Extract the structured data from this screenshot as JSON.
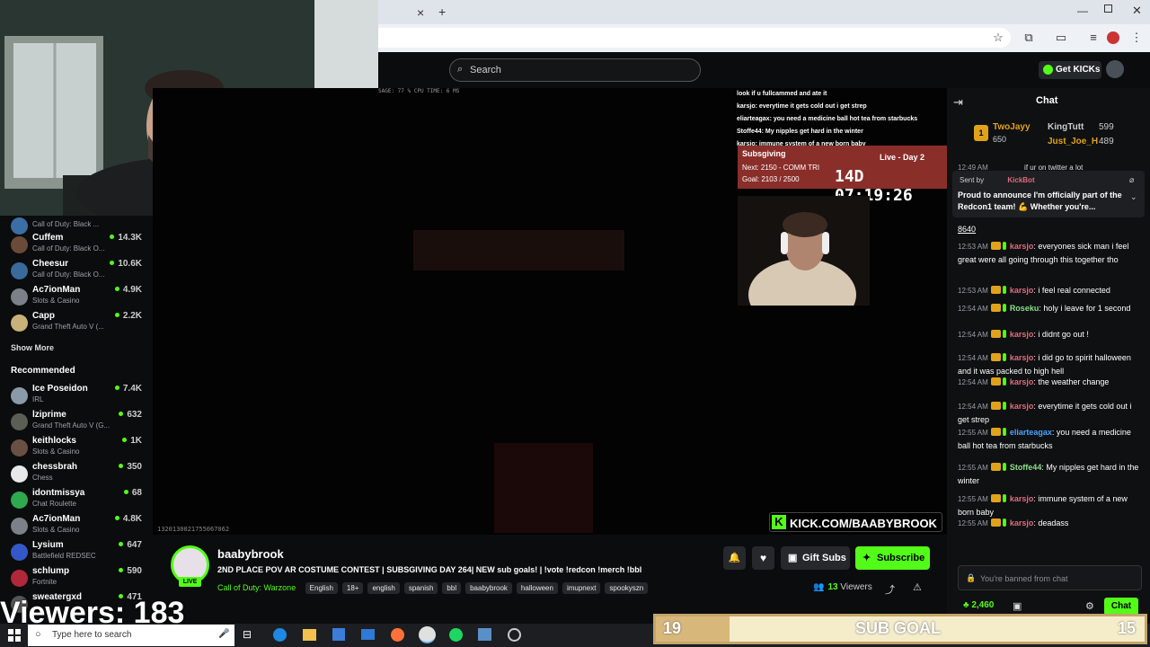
{
  "browser": {
    "tab_close": "×",
    "tab_add": "+"
  },
  "header": {
    "search_placeholder": "Search",
    "get_kicks": "Get KICKs"
  },
  "sidebar": {
    "top_items": [
      {
        "name": "",
        "category": "Call of Duty: Black ...",
        "viewers": ""
      },
      {
        "name": "Cuffem",
        "category": "Call of Duty: Black O...",
        "viewers": "14.3K"
      },
      {
        "name": "Cheesur",
        "category": "Call of Duty: Black O...",
        "viewers": "10.6K"
      },
      {
        "name": "Ac7ionMan",
        "category": "Slots & Casino",
        "viewers": "4.9K"
      },
      {
        "name": "Capp",
        "category": "Grand Theft Auto V (...",
        "viewers": "2.2K"
      }
    ],
    "show_more": "Show More",
    "recommended_title": "Recommended",
    "recommended": [
      {
        "name": "Ice Poseidon",
        "category": "IRL",
        "viewers": "7.4K"
      },
      {
        "name": "lziprime",
        "category": "Grand Theft Auto V (G...",
        "viewers": "632"
      },
      {
        "name": "keithlocks",
        "category": "Slots & Casino",
        "viewers": "1K"
      },
      {
        "name": "chessbrah",
        "category": "Chess",
        "viewers": "350"
      },
      {
        "name": "idontmissya",
        "category": "Chat Roulette",
        "viewers": "68"
      },
      {
        "name": "Ac7ionMan",
        "category": "Slots & Casino",
        "viewers": "4.8K"
      },
      {
        "name": "Lysium",
        "category": "Battlefield REDSEC",
        "viewers": "647"
      },
      {
        "name": "schlump",
        "category": "Fortnite",
        "viewers": "590"
      },
      {
        "name": "sweatergxd",
        "category": "",
        "viewers": "471"
      }
    ]
  },
  "player": {
    "stats_text": "SAGE: 77 %  CPU TIME: 6 MS",
    "bottom_id": "1320130021755067062",
    "overlay_chat": [
      "look if u fullcammed and ate it",
      "karsjo: everytime it gets cold out i get strep",
      "eliarteagax: you need a medicine ball hot tea from starbucks",
      "Stoffe44: My nipples get hard in the winter",
      "karsjo: immune system of a new born baby"
    ],
    "subsgiving": {
      "title": "Subsgiving",
      "next": "Next: 2150 - COMM TRI",
      "goal": "Goal: 2103 / 2500",
      "live_day": "Live - Day 2",
      "timer": "14D 07:19:26"
    },
    "kick_url": "KICK.COM/BAABYBROOK",
    "kick_k": "K"
  },
  "stream": {
    "streamer": "baabybrook",
    "live_badge": "LIVE",
    "title": "2ND PLACE POV AR COSTUME CONTEST | SUBSGIVING DAY 264| NEW sub goals! | !vote !redcon !merch !bbl",
    "category": "Call of Duty: Warzone",
    "tags": [
      "English",
      "18+",
      "english",
      "spanish",
      "bbl",
      "baabybrook",
      "halloween",
      "imupnext",
      "spookyszn"
    ],
    "gift_subs": "Gift Subs",
    "subscribe": "Subscribe",
    "viewers_count": "13",
    "viewers_label": "Viewers"
  },
  "chat": {
    "title": "Chat",
    "leaderboard": [
      {
        "rank": "1",
        "name": "TwoJayy",
        "score": "650"
      },
      {
        "name": "KingTutt",
        "score": "599"
      },
      {
        "name": "Just_Joe_H",
        "score": "489"
      }
    ],
    "pinned": {
      "time": "12:49 AM",
      "tail": "if ur on twitter a lot",
      "sent_by": "Sent by",
      "bot": "KickBot",
      "text": "Proud to announce I'm officially part of the Redcon1 team! 💪 Whether you're...",
      "under": "8640"
    },
    "messages": [
      {
        "time": "12:53 AM",
        "user": "karsjo",
        "color": "#e06b7d",
        "text": "everyones sick man i feel great were all going through this together tho"
      },
      {
        "time": "12:53 AM",
        "user": "karsjo",
        "color": "#e06b7d",
        "text": "i feel real connected"
      },
      {
        "time": "12:54 AM",
        "user": "Roseku",
        "color": "#8be08b",
        "text": "holy i leave for 1 second"
      },
      {
        "time": "12:54 AM",
        "user": "karsjo",
        "color": "#e06b7d",
        "text": "i didnt go out !"
      },
      {
        "time": "12:54 AM",
        "user": "karsjo",
        "color": "#e06b7d",
        "text": "i did go to spirit halloween and it was packed to high hell"
      },
      {
        "time": "12:54 AM",
        "user": "karsjo",
        "color": "#e06b7d",
        "text": "the weather change"
      },
      {
        "time": "12:54 AM",
        "user": "karsjo",
        "color": "#e06b7d",
        "text": "everytime it gets cold out i get strep"
      },
      {
        "time": "12:55 AM",
        "user": "eliarteagax",
        "color": "#4aa3ff",
        "text": "you need a medicine ball hot tea from starbucks"
      },
      {
        "time": "12:55 AM",
        "user": "Stoffe44",
        "color": "#8be08b",
        "text": "My nipples get hard in the winter"
      },
      {
        "time": "12:55 AM",
        "user": "karsjo",
        "color": "#e06b7d",
        "text": "immune system of a new born baby"
      },
      {
        "time": "12:55 AM",
        "user": "karsjo",
        "color": "#e06b7d",
        "text": "deadass"
      }
    ],
    "banned_text": "You're banned from chat",
    "points": "2,460",
    "chat_button": "Chat"
  },
  "overlay": {
    "viewers_text": "Viewers: 183"
  },
  "sub_goal": {
    "left": "19",
    "label": "SUB GOAL",
    "right": "15"
  },
  "taskbar": {
    "search_placeholder": "Type here to search"
  },
  "colors": {
    "kick_green": "#53fc18",
    "chat_bg": "#0f1012"
  }
}
